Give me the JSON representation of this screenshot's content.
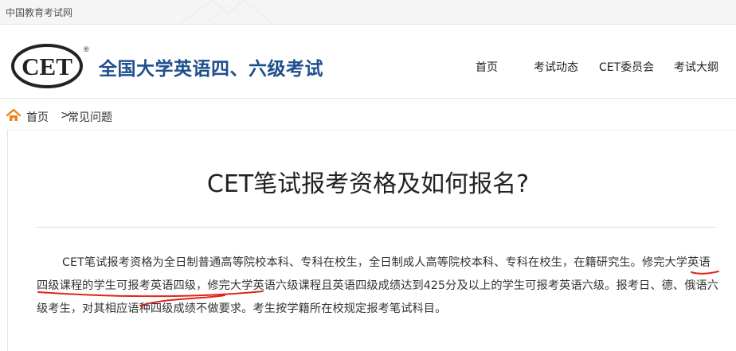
{
  "topbar": {
    "site_link": "中国教育考试网"
  },
  "header": {
    "logo_text": "CET",
    "logo_mark": "®",
    "site_title": "全国大学英语四、六级考试",
    "nav": [
      "首页",
      "考试动态",
      "CET委员会",
      "考试大纲"
    ]
  },
  "breadcrumb": {
    "home": "首页",
    "separator": ">",
    "current": "常见问题"
  },
  "article": {
    "title": "CET笔试报考资格及如何报名?",
    "para_1": "CET笔试报考资格为全日制普通高等院校本科、专科在校生，全日制成人高等院校本科、专科在校生，在籍研究生。",
    "para_2": "修完大学英语四级课程的学生可报考英语四级，",
    "para_3": "修完大学英语六级课程且英语四级成绩达到425分及以上的学生可报考英语六级。报考日、德、俄语六级考生，对其相应语种四级成绩不做要求。考生按学籍所在校规定报考笔试科目。"
  },
  "colors": {
    "accent": "#1f4e8c",
    "home_icon": "#e8841a",
    "annotation": "#e0241b"
  },
  "icons": {
    "home": "home-icon"
  }
}
